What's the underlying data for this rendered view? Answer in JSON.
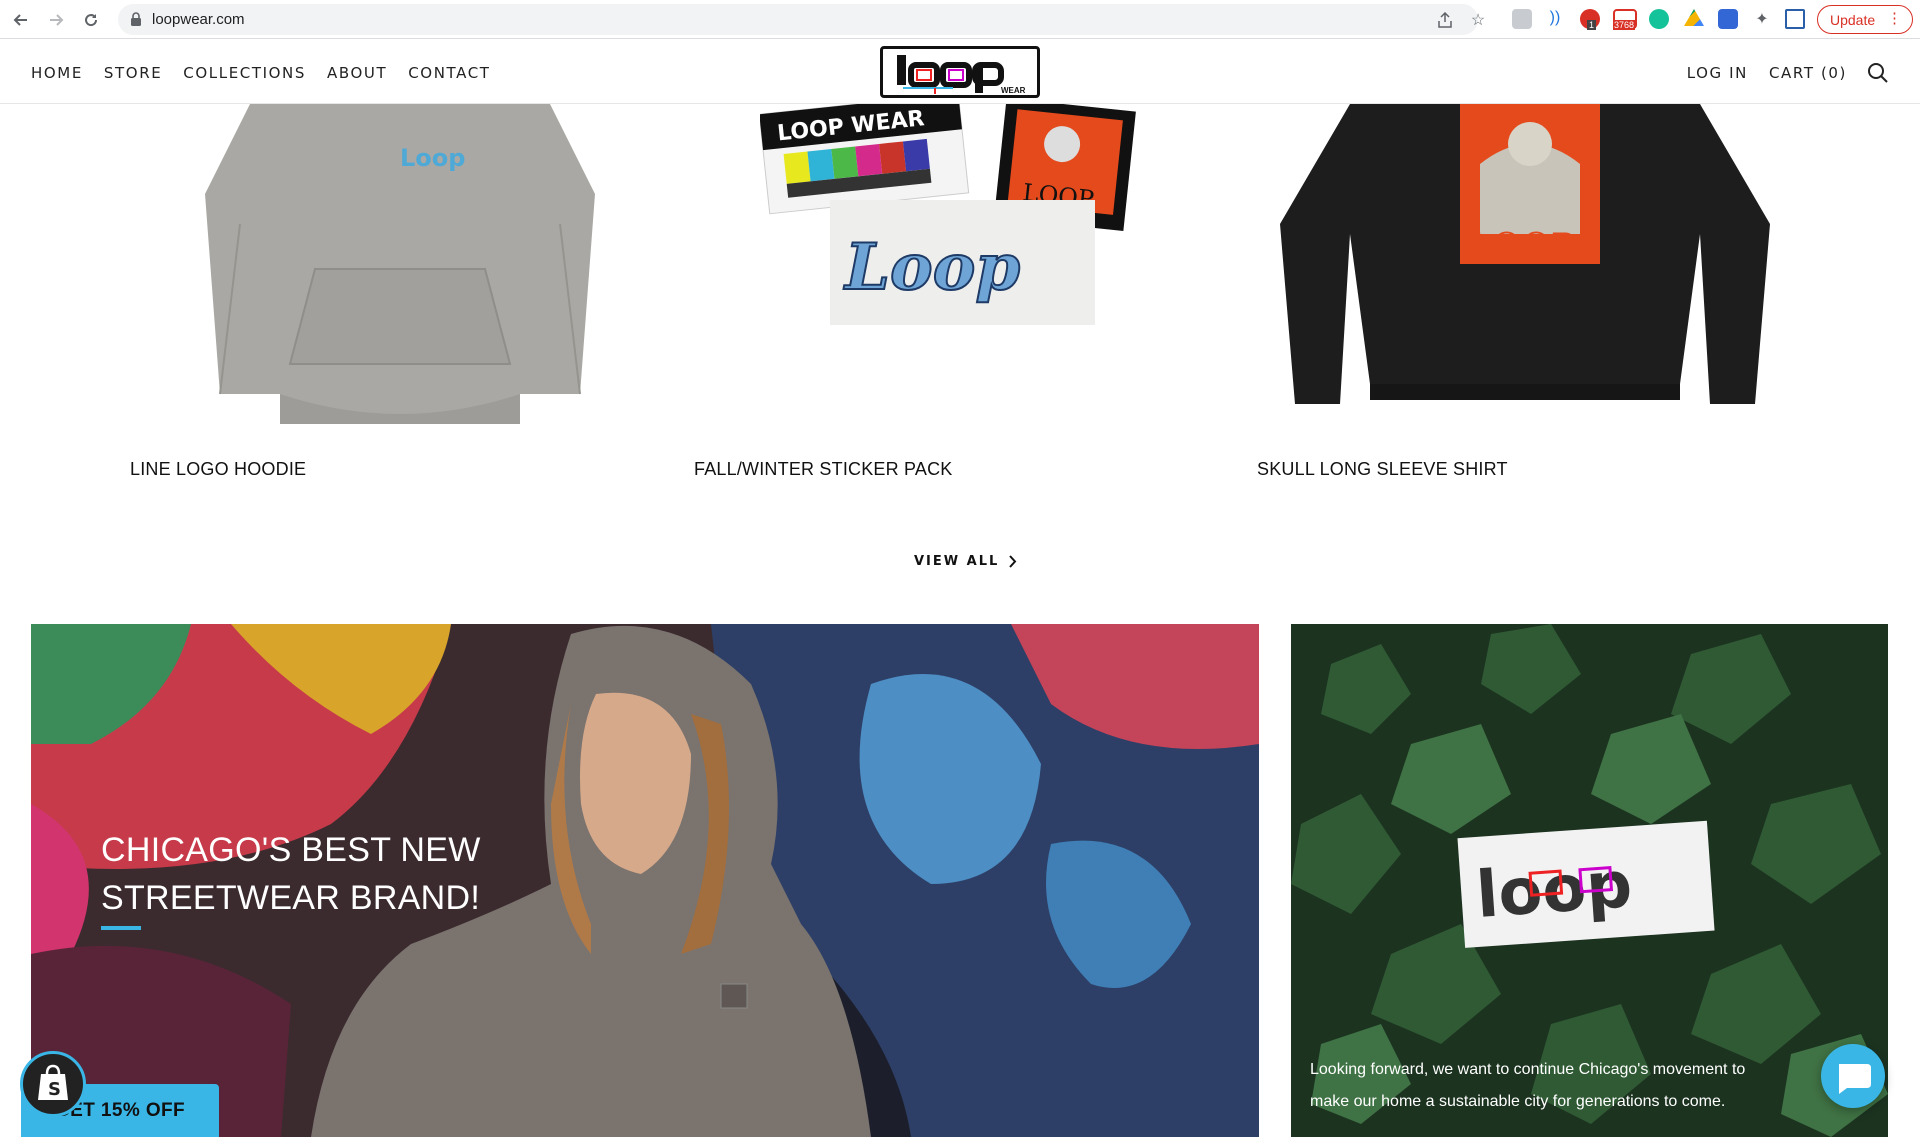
{
  "browser": {
    "url": "loopwear.com",
    "update_label": "Update",
    "badge_count": "3768",
    "abp_count": "1"
  },
  "header": {
    "nav": [
      "HOME",
      "STORE",
      "COLLECTIONS",
      "ABOUT",
      "CONTACT"
    ],
    "login_label": "LOG IN",
    "cart_label": "CART (0)",
    "logo_text": "loop",
    "logo_sub": "WEAR"
  },
  "products": [
    {
      "title": "LINE LOGO HOODIE",
      "print": "Loop"
    },
    {
      "title": "FALL/WINTER STICKER PACK",
      "print": "LOOP WEAR"
    },
    {
      "title": "SKULL LONG SLEEVE SHIRT",
      "print": "LOOP"
    }
  ],
  "view_all_label": "VIEW ALL",
  "banner_left": {
    "headline": "CHICAGO'S BEST NEW STREETWEAR BRAND!"
  },
  "banner_right": {
    "text": "Looking forward, we want to continue Chicago's movement to make our home a sustainable city for generations to come."
  },
  "discount_label": "GET 15% OFF",
  "colors": {
    "accent": "#3ab6e6",
    "text": "#111111",
    "update_red": "#d93025"
  },
  "icons": [
    "back-arrow-icon",
    "forward-arrow-icon",
    "reload-icon",
    "lock-icon",
    "share-icon",
    "star-icon",
    "extensions-icon",
    "search-icon",
    "chevron-right-icon",
    "shopify-bag-icon",
    "chat-bubble-icon"
  ]
}
